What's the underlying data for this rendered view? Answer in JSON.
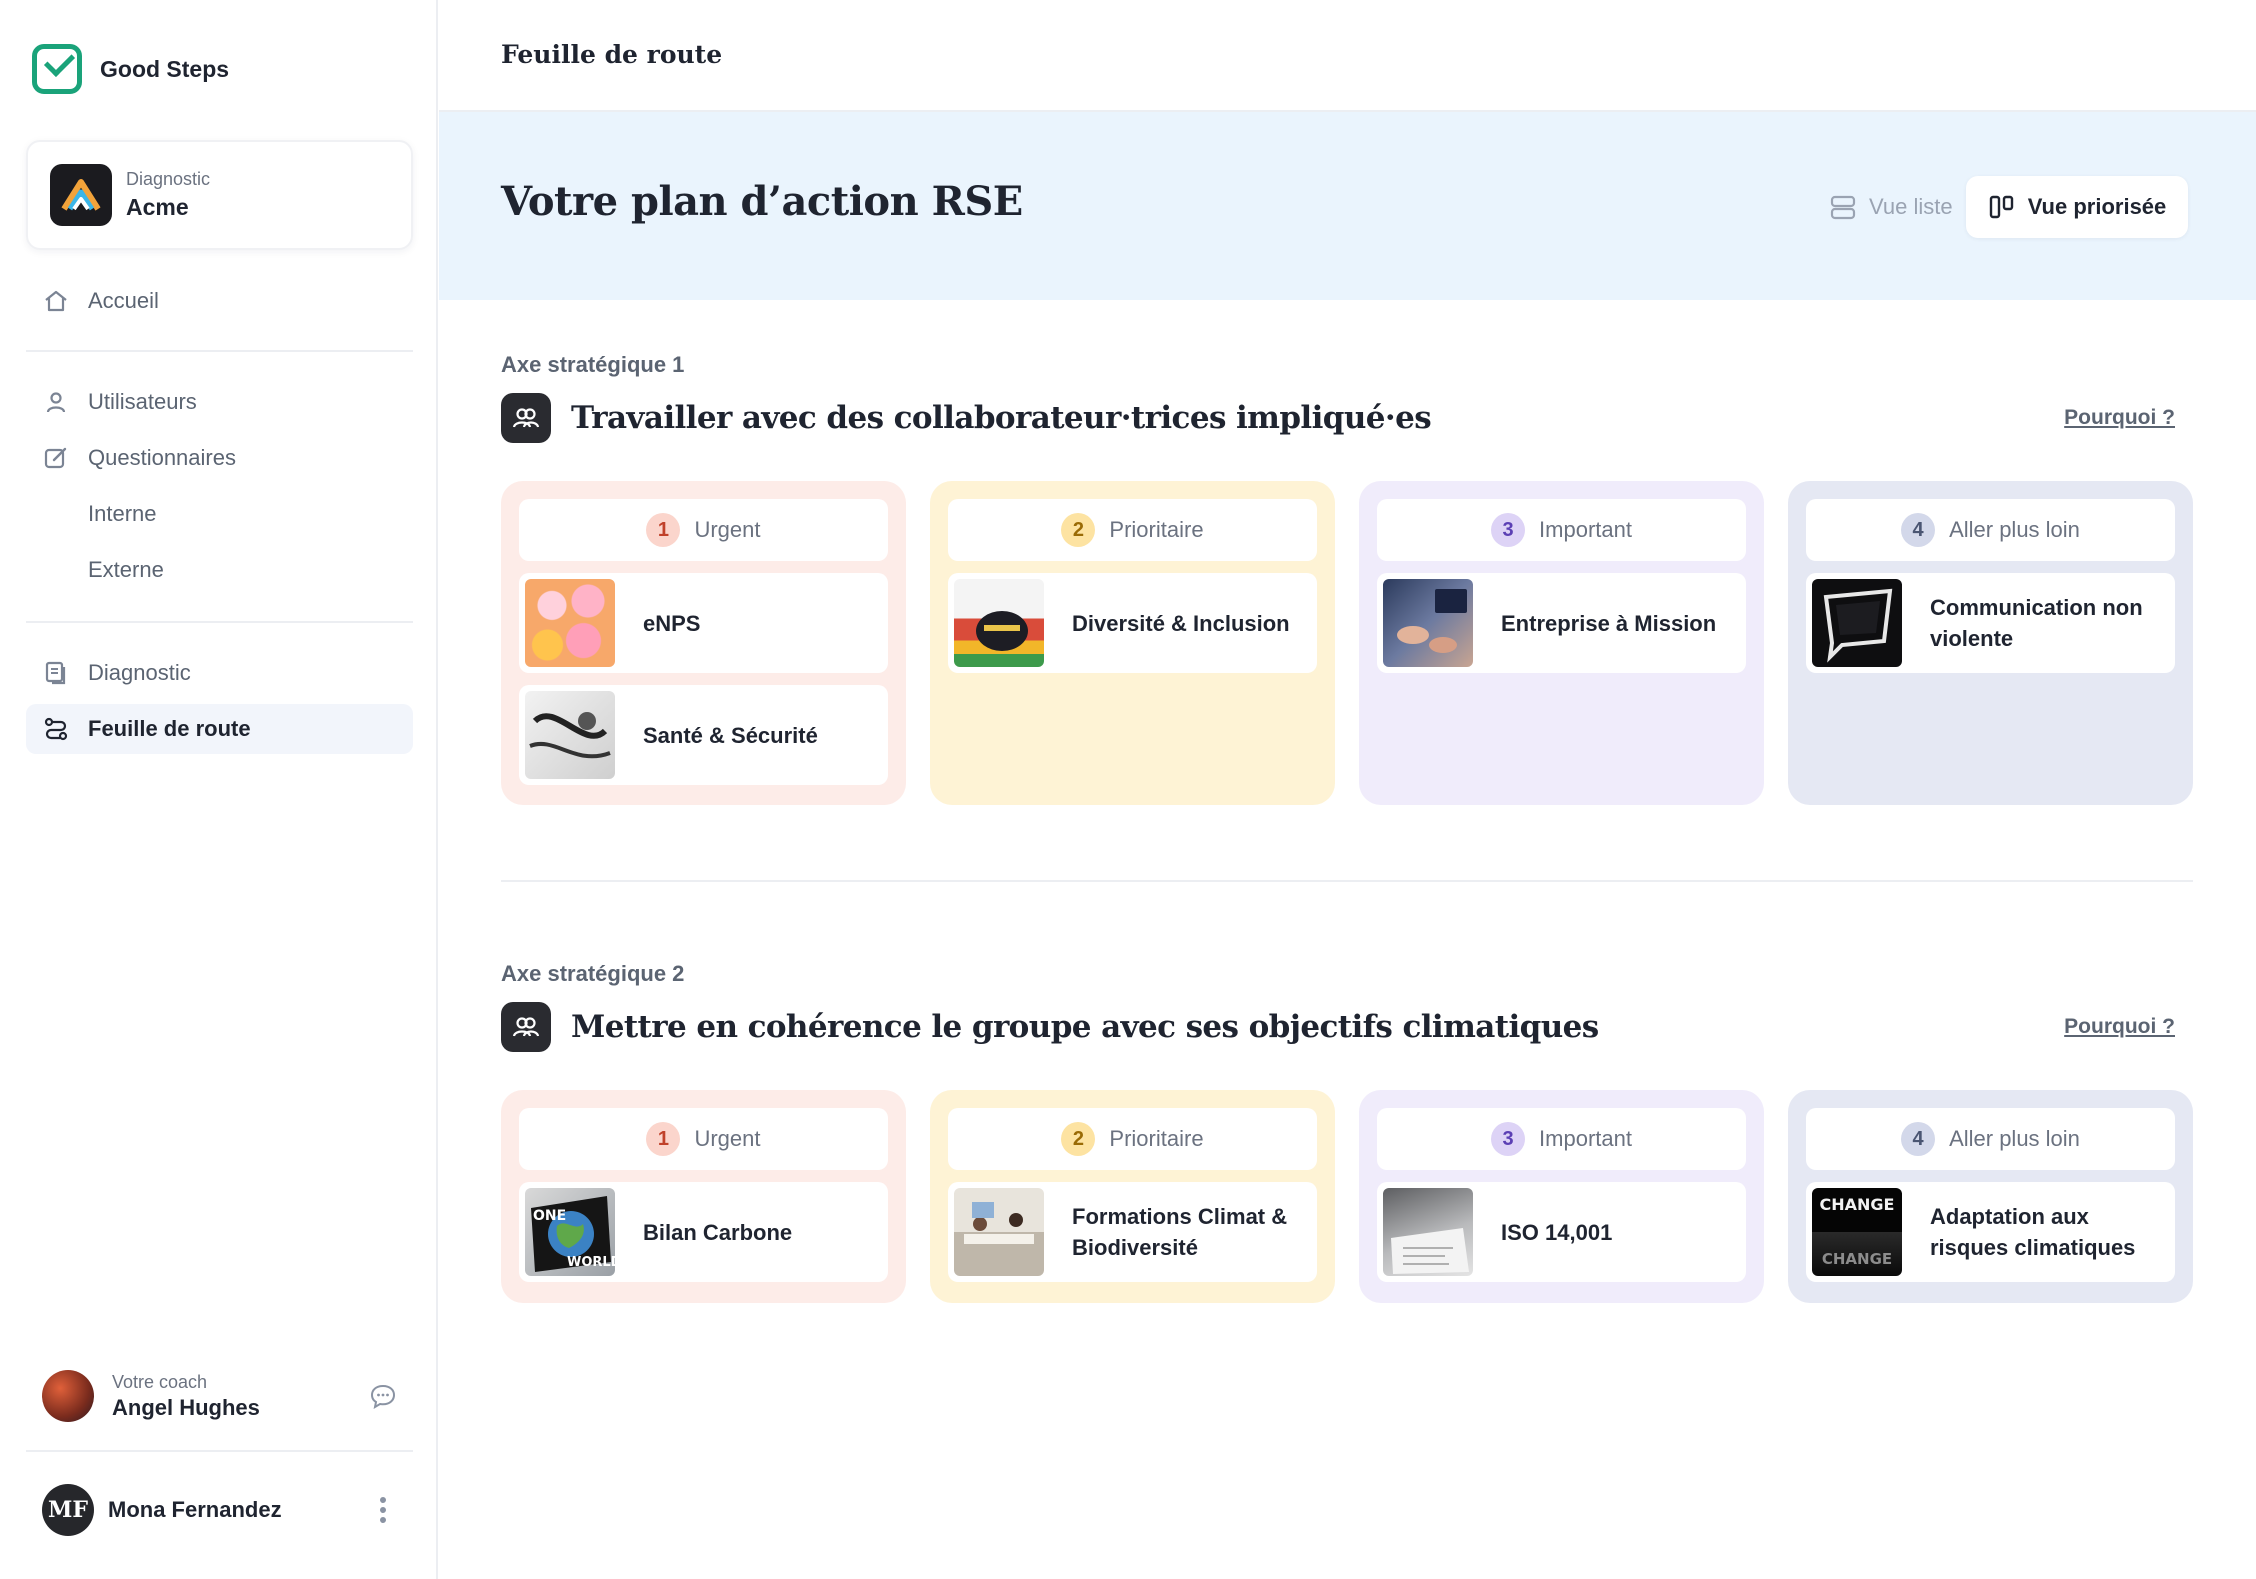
{
  "app": {
    "name": "Good Steps",
    "brand_color": "#1aa37a"
  },
  "org": {
    "kicker": "Diagnostic",
    "name": "Acme"
  },
  "nav": {
    "home": "Accueil",
    "users": "Utilisateurs",
    "questionnaires": "Questionnaires",
    "internal": "Interne",
    "external": "Externe",
    "diagnostic": "Diagnostic",
    "roadmap": "Feuille de route"
  },
  "coach": {
    "kicker": "Votre coach",
    "name": "Angel Hughes"
  },
  "user": {
    "initials": "MF",
    "name": "Mona Fernandez"
  },
  "header": {
    "title": "Feuille de route"
  },
  "hero": {
    "title": "Votre plan d’action RSE",
    "view_list": "Vue liste",
    "view_prioritized": "Vue priorisée"
  },
  "columns": {
    "urgent": {
      "number": "1",
      "label": "Urgent",
      "color": "#fdece8"
    },
    "prio": {
      "number": "2",
      "label": "Prioritaire",
      "color": "#fef3d5"
    },
    "imp": {
      "number": "3",
      "label": "Important",
      "color": "#f0ecfb"
    },
    "far": {
      "number": "4",
      "label": "Aller plus loin",
      "color": "#e5e8f3"
    }
  },
  "axes": [
    {
      "kicker": "Axe stratégique 1",
      "title": "Travailler avec des collaborateur·trices impliqué·es",
      "why": "Pourquoi ?",
      "urgent": [
        "eNPS",
        "Santé & Sécurité"
      ],
      "prio": [
        "Diversité & Inclusion"
      ],
      "imp": [
        "Entreprise à Mission"
      ],
      "far": [
        "Communication non violente"
      ]
    },
    {
      "kicker": "Axe stratégique 2",
      "title": "Mettre en cohérence le groupe avec ses objectifs climatiques",
      "why": "Pourquoi ?",
      "urgent": [
        "Bilan Carbone"
      ],
      "prio": [
        "Formations Climat & Biodiversité"
      ],
      "imp": [
        "ISO 14,001"
      ],
      "far": [
        "Adaptation aux risques climatiques"
      ],
      "far_thumb_text": {
        "top": "CHANGE",
        "bottom": "CHANGE"
      },
      "urgent_thumb_text": {
        "top": "ONE",
        "bottom": "WORLD"
      }
    }
  ]
}
